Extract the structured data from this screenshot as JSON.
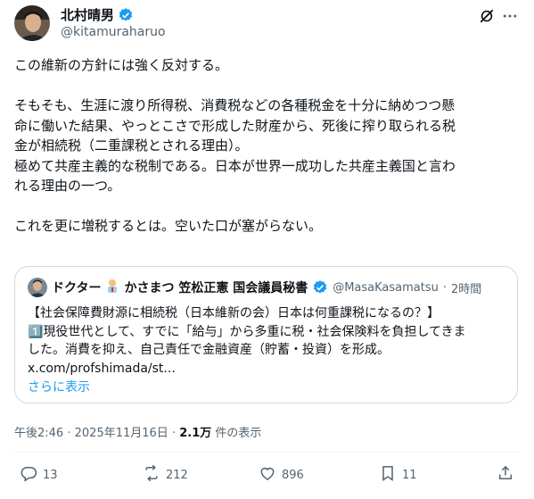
{
  "author": {
    "name": "北村晴男",
    "handle": "@kitamuraharuo"
  },
  "post": {
    "text": "この維新の方針には強く反対する。\n\nそもそも、生涯に渡り所得税、消費税などの各種税金を十分に納めつつ懸\n命に働いた結果、やっとこさで形成した財産から、死後に搾り取られる税\n金が相続税（二重課税とされる理由）。\n極めて共産主義的な税制である。日本が世界一成功した共産主義国と言わ\nれる理由の一つ。\n\nこれを更に増税するとは。空いた口が塞がらない。"
  },
  "quote": {
    "name_part1": "ドクター",
    "name_part2": "かさまつ 笠松正憲 国会議員秘書",
    "handle": "@MasaKasamatsu",
    "sep": "·",
    "time": "2時間",
    "text": "【社会保障費財源に相続税（日本維新の会）日本は何重課税になるの？】\n1️⃣現役世代として、すでに「給与」から多重に税・社会保険料を負担してきま\nした。消費を抑え、自己責任で金融資産（貯蓄・投資）を形成。\nx.com/profshimada/st...",
    "show_more": "さらに表示"
  },
  "meta": {
    "time": "午後2:46",
    "sep1": "·",
    "date": "2025年11月16日",
    "sep2": "·",
    "views": "2.1万",
    "views_label": "件の表示"
  },
  "actions": {
    "replies": "13",
    "reposts": "212",
    "likes": "896",
    "bookmarks": "11"
  },
  "colors": {
    "verified": "#1d9bf0",
    "text": "#0f1419",
    "secondary": "#536471",
    "link": "#1d9bf0",
    "border": "#cfd9de"
  },
  "icons": [
    "verified-icon",
    "grok-icon",
    "more-icon",
    "reply-icon",
    "repost-icon",
    "like-icon",
    "bookmark-icon",
    "share-icon"
  ]
}
